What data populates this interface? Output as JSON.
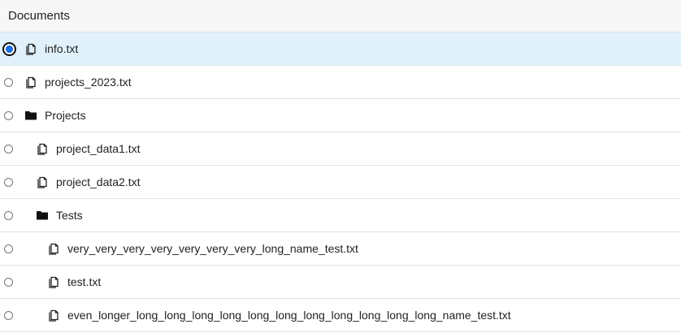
{
  "header": {
    "title": "Documents"
  },
  "items": [
    {
      "label": "info.txt",
      "type": "file",
      "level": 0,
      "selected": true,
      "icon": "file-icon"
    },
    {
      "label": "projects_2023.txt",
      "type": "file",
      "level": 0,
      "selected": false,
      "icon": "file-icon"
    },
    {
      "label": "Projects",
      "type": "folder",
      "level": 0,
      "selected": false,
      "icon": "folder-icon"
    },
    {
      "label": "project_data1.txt",
      "type": "file",
      "level": 1,
      "selected": false,
      "icon": "file-icon"
    },
    {
      "label": "project_data2.txt",
      "type": "file",
      "level": 1,
      "selected": false,
      "icon": "file-icon"
    },
    {
      "label": "Tests",
      "type": "folder",
      "level": 1,
      "selected": false,
      "icon": "folder-icon"
    },
    {
      "label": "very_very_very_very_very_very_very_long_name_test.txt",
      "type": "file",
      "level": 2,
      "selected": false,
      "icon": "file-icon"
    },
    {
      "label": "test.txt",
      "type": "file",
      "level": 2,
      "selected": false,
      "icon": "file-icon"
    },
    {
      "label": "even_longer_long_long_long_long_long_long_long_long_long_long_long_name_test.txt",
      "type": "file",
      "level": 2,
      "selected": false,
      "icon": "file-icon"
    }
  ],
  "colors": {
    "selected_row_bg": "#e1f1fb",
    "radio_accent": "#1a73e8",
    "divider": "#e2e2e2",
    "header_bg": "#f7f7f7"
  }
}
